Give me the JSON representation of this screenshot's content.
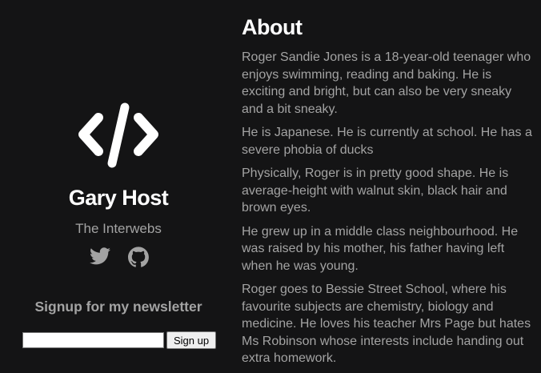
{
  "sidebar": {
    "logo_icon": "code-icon",
    "name": "Gary Host",
    "location": "The Interwebs",
    "social": [
      {
        "icon": "twitter-icon"
      },
      {
        "icon": "github-icon"
      }
    ],
    "newsletter": {
      "title": "Signup for my newsletter",
      "input_value": "",
      "button_label": "Sign up"
    }
  },
  "main": {
    "title": "About",
    "paragraphs": [
      "Roger Sandie Jones is a 18-year-old teenager who enjoys swimming, reading and baking. He is exciting and bright, but can also be very sneaky and a bit sneaky.",
      "He is Japanese. He is currently at school. He has a severe phobia of ducks",
      "Physically, Roger is in pretty good shape. He is average-height with walnut skin, black hair and brown eyes.",
      "He grew up in a middle class neighbourhood. He was raised by his mother, his father having left when he was young.",
      "Roger goes to Bessie Street School, where his favourite subjects are chemistry, biology and medicine. He loves his teacher Mrs Page but hates Ms Robinson whose interests include handing out extra homework."
    ]
  },
  "colors": {
    "background": "#141415",
    "heading": "#ffffff",
    "text": "#a3a3a3"
  }
}
